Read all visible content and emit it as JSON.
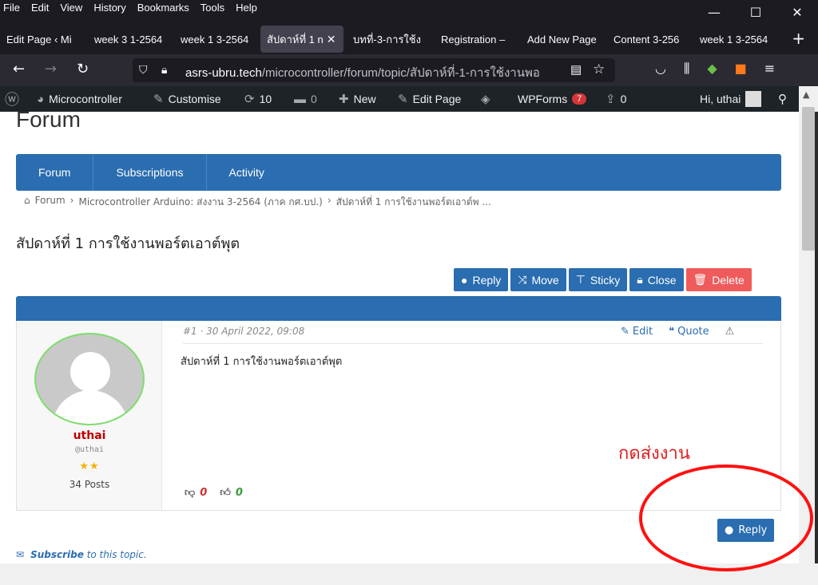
{
  "menubar": {
    "items": [
      "File",
      "Edit",
      "View",
      "History",
      "Bookmarks",
      "Tools",
      "Help"
    ],
    "minimize": "—",
    "maximize": "☐",
    "close": "✕"
  },
  "tabs": [
    {
      "label": "Edit Page ‹ Mi"
    },
    {
      "label": "week 3 1-2564"
    },
    {
      "label": "week 1 3-2564"
    },
    {
      "label": "สัปดาห์ที่ 1 n",
      "active": true
    },
    {
      "label": "บทที่-3-การใช้ง"
    },
    {
      "label": "Registration –"
    },
    {
      "label": "Add New Page"
    },
    {
      "label": "Content 3-256"
    },
    {
      "label": "week 1 3-2564"
    }
  ],
  "navbar": {
    "url_host": "asrs-ubru.tech",
    "url_path": "/microcontroller/forum/topic/สัปดาห์ที่-1-การใช้งานพอ"
  },
  "wpbar": {
    "site": "Microcontroller",
    "customise": "Customise",
    "updates": "10",
    "comments": "0",
    "new": "New",
    "edit_page": "Edit Page",
    "wpforms": "WPForms",
    "wpforms_badge": "7",
    "share_count": "0",
    "greeting": "Hi, uthai"
  },
  "forum": {
    "heading": "Forum",
    "nav": [
      "Forum",
      "Subscriptions",
      "Activity"
    ],
    "breadcrumb": [
      "Forum",
      "Microcontroller Arduino: ส่งงาน 3-2564 (ภาค กศ.บป.)",
      "สัปดาห์ที่ 1 การใช้งานพอร์ตเอาต์พ ..."
    ],
    "topic_title": "สัปดาห์ที่ 1 การใช้งานพอร์ตเอาต์พุต",
    "actions": {
      "reply": "Reply",
      "move": "Move",
      "sticky": "Sticky",
      "close": "Close",
      "delete": "Delete"
    },
    "post": {
      "meta": "#1 · 30 April 2022, 09:08",
      "edit": "Edit",
      "quote": "Quote",
      "body": "สัปดาห์ที่ 1 การใช้งานพอร์ตเอาต์พุต",
      "author_name": "uthai",
      "author_handle": "@uthai",
      "author_stars": "★★",
      "author_posts": "34 Posts",
      "downvotes": "0",
      "upvotes": "0"
    },
    "reply_bottom": "Reply",
    "subscribe": "Subscribe",
    "subscribe_rest": "to this topic."
  },
  "annotation": {
    "note": "กดส่งงาน",
    "color": "#ff1010"
  },
  "colors": {
    "accent": "#2a6db0",
    "delete": "#ef5b5b"
  }
}
